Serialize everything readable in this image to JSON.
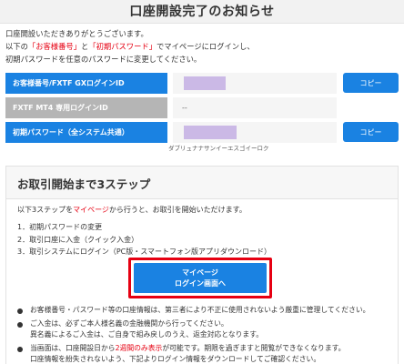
{
  "header": {
    "title": "口座開設完了のお知らせ"
  },
  "intro": {
    "line1": "口座開設いただきありがとうございます。",
    "line2_pre": "以下の",
    "line2_red1": "「お客様番号」",
    "line2_mid": "と",
    "line2_red2": "「初期パスワード」",
    "line2_post": "でマイページにログインし、",
    "line3": "初期パスワードを任意のパスワードに変更してください。"
  },
  "account_info": {
    "rows": [
      {
        "label": "お客様番号/FXTF GXログインID",
        "value": "",
        "masked": true,
        "copy": "コピー"
      },
      {
        "label": "FXTF MT4 専用ログインID",
        "value": "--",
        "masked": false
      },
      {
        "label": "初期パスワード（全システム共通）",
        "value": "",
        "masked": true,
        "copy": "コピー"
      }
    ],
    "kana_hint": "ダブリュナナサンイーエスゴイーロク"
  },
  "steps": {
    "title": "お取引開始まで3ステップ",
    "lead_pre": "以下3ステップを",
    "lead_red": "マイページ",
    "lead_post": "から行うと、お取引を開始いただけます。",
    "items": [
      "1．初期パスワードの変更",
      "2．取引口座に入金（クイック入金）",
      "3．取引システムにログイン（PC版・スマートフォン版アプリダウンロード）"
    ],
    "login_button": {
      "line1": "マイページ",
      "line2": "ログイン画面へ"
    }
  },
  "notes": [
    {
      "text": "お客様番号・パスワード等の口座情報は、第三者により不正に使用されないよう厳重に管理してください。"
    },
    {
      "line1": "ご入金は、必ずご本人様名義の金融機関から行ってください。",
      "line2": "異名義によるご入金は、ご自身で組み戻しのうえ、返金対応となります。"
    },
    {
      "pre": "当画面は、口座開設日から",
      "red": "2週間のみ表示",
      "post": "が可能です。期限を過ぎますと閲覧ができなくなります。",
      "line2": "口座情報を紛失されないよう、下記よりログイン情報をダウンロードしてご確認ください。"
    }
  ],
  "colors": {
    "primary": "#1a82e2",
    "accent_red": "#e60012",
    "label_gray": "#b5b5b5",
    "mask": "#cbb9e6"
  }
}
